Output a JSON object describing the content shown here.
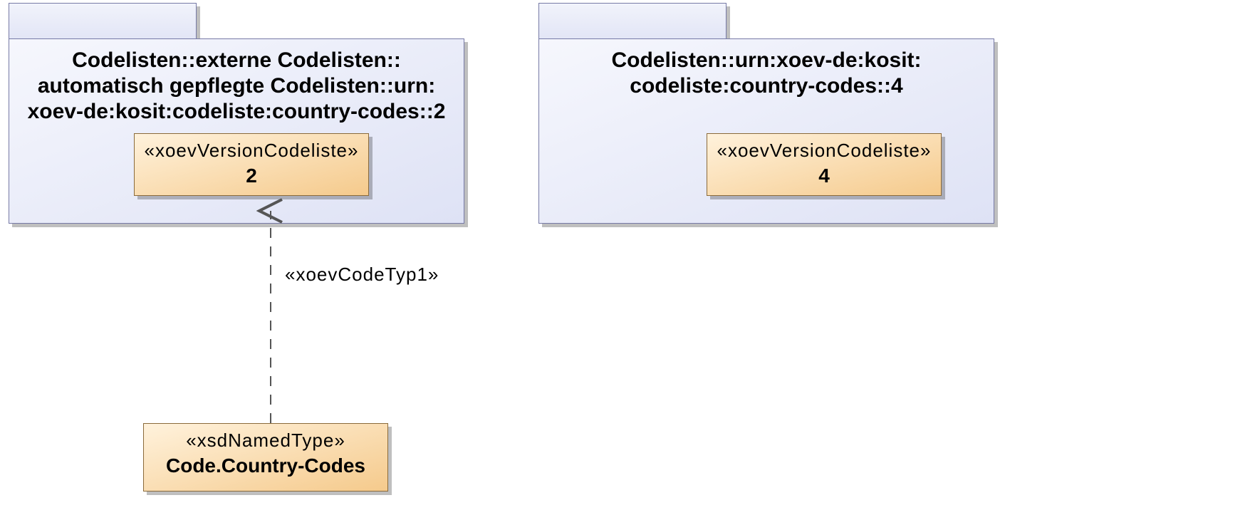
{
  "package1": {
    "titleLine1": "Codelisten::externe Codelisten::",
    "titleLine2": "automatisch gepflegte Codelisten::urn:",
    "titleLine3": "xoev-de:kosit:codeliste:country-codes::2",
    "versionBox": {
      "stereotype": "«xoevVersionCodeliste»",
      "name": "2"
    }
  },
  "package2": {
    "titleLine1": "Codelisten::urn:xoev-de:kosit:",
    "titleLine2": "codeliste:country-codes::4",
    "versionBox": {
      "stereotype": "«xoevVersionCodeliste»",
      "name": "4"
    }
  },
  "dependency": {
    "label": "«xoevCodeTyp1»"
  },
  "typeBox": {
    "stereotype": "«xsdNamedType»",
    "name": "Code.Country-Codes"
  }
}
